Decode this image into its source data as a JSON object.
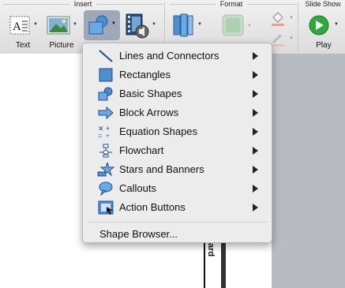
{
  "ribbon": {
    "groups": [
      "Insert",
      "Format",
      "Slide Show"
    ],
    "text_label": "Text",
    "picture_label": "Picture",
    "play_label": "Play"
  },
  "menu": {
    "items": [
      {
        "label": "Lines and Connectors",
        "icon": "line-icon"
      },
      {
        "label": "Rectangles",
        "icon": "rectangle-icon"
      },
      {
        "label": "Basic Shapes",
        "icon": "basic-shapes-icon"
      },
      {
        "label": "Block Arrows",
        "icon": "block-arrow-icon"
      },
      {
        "label": "Equation Shapes",
        "icon": "equation-icon"
      },
      {
        "label": "Flowchart",
        "icon": "flowchart-icon"
      },
      {
        "label": "Stars and Banners",
        "icon": "star-icon"
      },
      {
        "label": "Callouts",
        "icon": "callout-icon"
      },
      {
        "label": "Action Buttons",
        "icon": "action-button-icon"
      }
    ],
    "browser_label": "Shape Browser..."
  },
  "slide": {
    "strip_text": "ard"
  },
  "colors": {
    "accent": "#2f6fbf",
    "play_green": "#2eaa3c"
  }
}
